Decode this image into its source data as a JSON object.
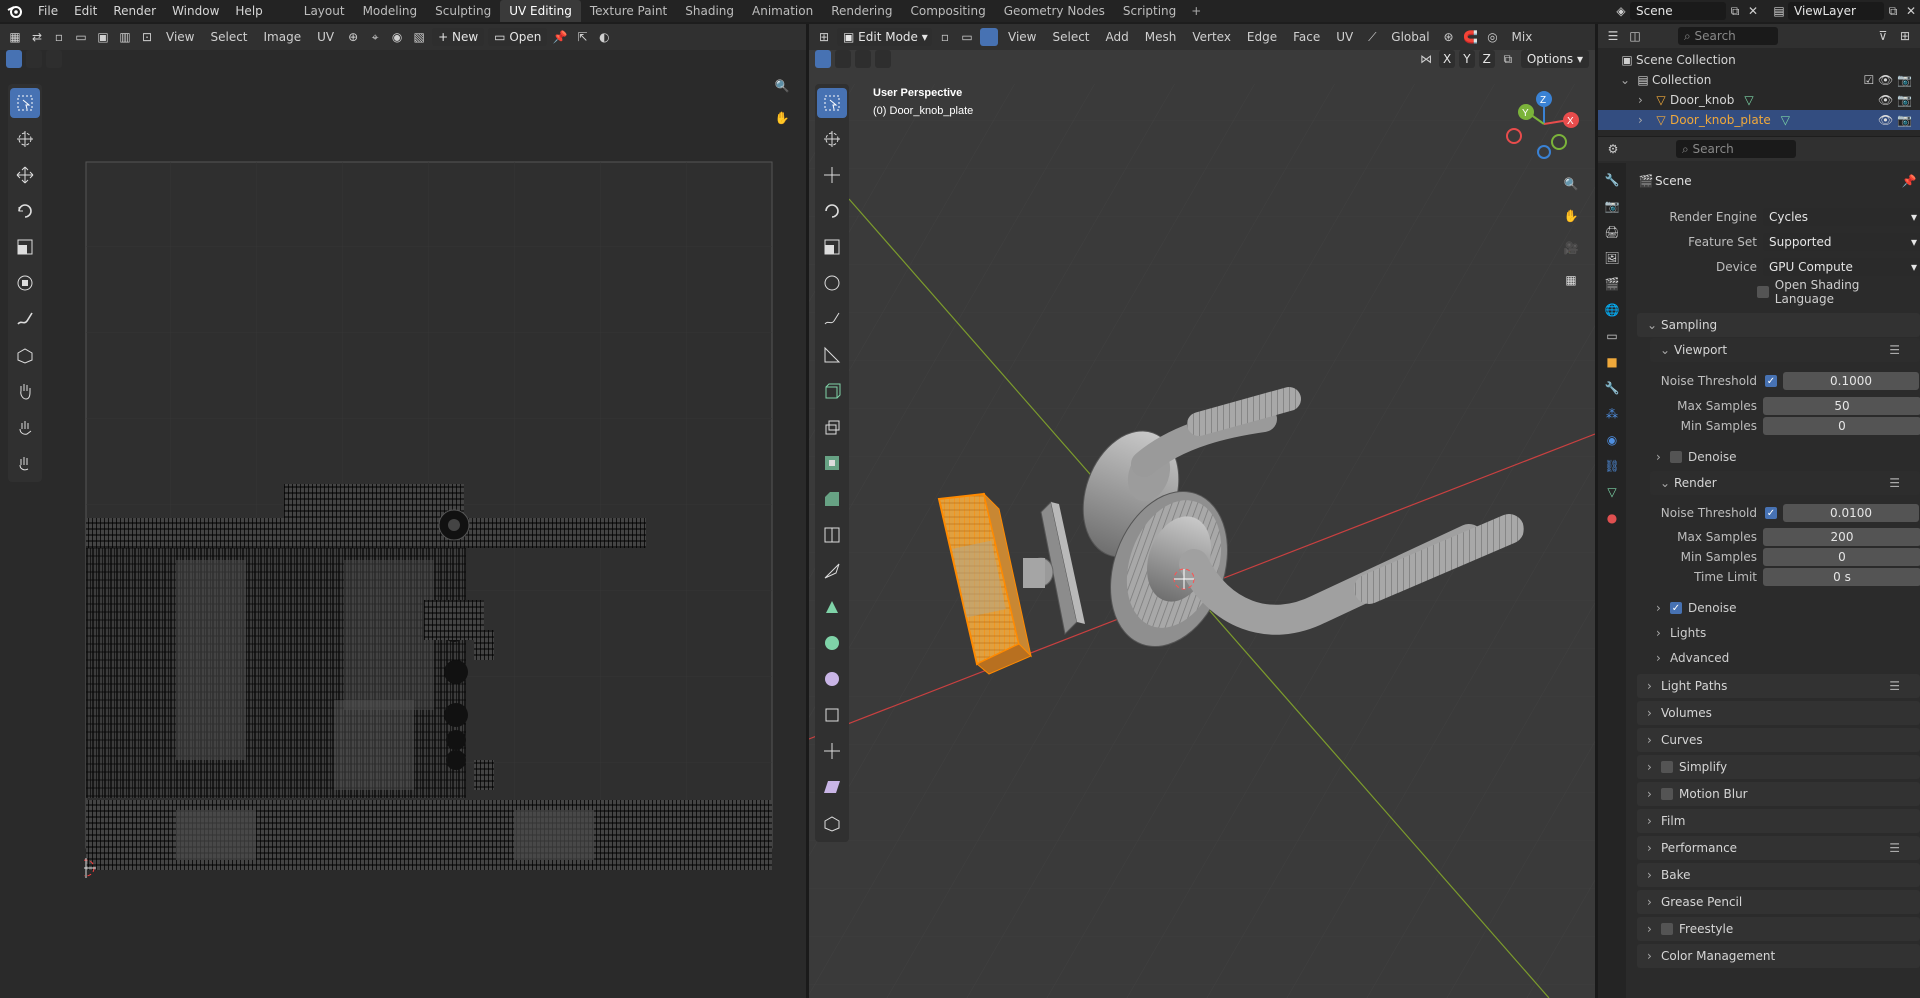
{
  "topbar": {
    "menus": [
      "File",
      "Edit",
      "Render",
      "Window",
      "Help"
    ],
    "workspaces": [
      "Layout",
      "Modeling",
      "Sculpting",
      "UV Editing",
      "Texture Paint",
      "Shading",
      "Animation",
      "Rendering",
      "Compositing",
      "Geometry Nodes",
      "Scripting"
    ],
    "active_workspace": "UV Editing",
    "scene": "Scene",
    "view_layer": "ViewLayer"
  },
  "uv_editor": {
    "menus": [
      "View",
      "Select",
      "Image",
      "UV"
    ],
    "new_label": "New",
    "open_label": "Open"
  },
  "viewport": {
    "mode": "Edit Mode",
    "menus": [
      "View",
      "Select",
      "Add",
      "Mesh",
      "Vertex",
      "Edge",
      "Face",
      "UV"
    ],
    "orientation": "Global",
    "shading_mix": "Mix",
    "options_label": "Options",
    "axis_labels": [
      "X",
      "Y",
      "Z"
    ],
    "overlay_title": "User Perspective",
    "overlay_object": "(0) Door_knob_plate",
    "gizmo": {
      "x": "X",
      "y": "Y",
      "z": "Z"
    }
  },
  "outliner": {
    "search_placeholder": "Search",
    "scene_collection": "Scene Collection",
    "collection": "Collection",
    "items": [
      {
        "name": "Door_knob",
        "selected": false
      },
      {
        "name": "Door_knob_plate",
        "selected": true
      }
    ]
  },
  "properties": {
    "search_placeholder": "Search",
    "context": "Scene",
    "render_engine_label": "Render Engine",
    "render_engine": "Cycles",
    "feature_set_label": "Feature Set",
    "feature_set": "Supported",
    "device_label": "Device",
    "device": "GPU Compute",
    "osl_label": "Open Shading Language",
    "sampling": "Sampling",
    "viewport": "Viewport",
    "viewport_noise_label": "Noise Threshold",
    "viewport_noise": "0.1000",
    "viewport_max_label": "Max Samples",
    "viewport_max": "50",
    "viewport_min_label": "Min Samples",
    "viewport_min": "0",
    "viewport_denoise": "Denoise",
    "render": "Render",
    "render_noise_label": "Noise Threshold",
    "render_noise": "0.0100",
    "render_max_label": "Max Samples",
    "render_max": "200",
    "render_min_label": "Min Samples",
    "render_min": "0",
    "time_limit_label": "Time Limit",
    "time_limit": "0 s",
    "render_denoise": "Denoise",
    "lights": "Lights",
    "advanced": "Advanced",
    "panels": [
      "Light Paths",
      "Volumes",
      "Curves",
      "Simplify",
      "Motion Blur",
      "Film",
      "Performance",
      "Bake",
      "Grease Pencil",
      "Freestyle",
      "Color Management"
    ]
  },
  "colors": {
    "accent": "#4772b3",
    "selection": "#f0a93b",
    "x_axis": "#e84c4c",
    "y_axis": "#7bb33a",
    "z_axis": "#3a82d4"
  }
}
